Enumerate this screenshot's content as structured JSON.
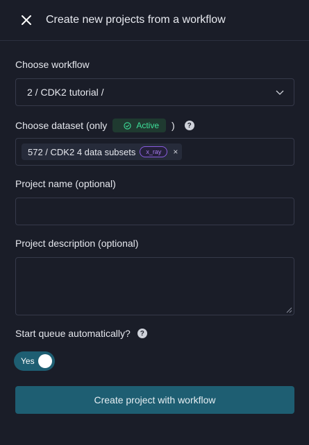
{
  "header": {
    "title": "Create new projects from a workflow",
    "close_icon": "close-icon"
  },
  "workflow": {
    "label": "Choose workflow",
    "selected": "2 / CDK2 tutorial /"
  },
  "dataset": {
    "label_prefix": "Choose dataset (only",
    "active_badge": "Active",
    "label_suffix": ")",
    "help_icon": "?",
    "selected_chip": "572 / CDK2 4 data subsets",
    "chip_tag": "x_ray",
    "chip_remove": "×"
  },
  "project_name": {
    "label": "Project name (optional)",
    "value": "",
    "placeholder": ""
  },
  "project_description": {
    "label": "Project description (optional)",
    "value": "",
    "placeholder": ""
  },
  "start_queue": {
    "label": "Start queue automatically?",
    "help_icon": "?",
    "toggle_label": "Yes",
    "enabled": true
  },
  "submit": {
    "label": "Create project with workflow"
  },
  "colors": {
    "background": "#1a1d28",
    "accent": "#1e5e72",
    "active_green": "#3ee09a",
    "tag_purple": "#a97cf0"
  }
}
